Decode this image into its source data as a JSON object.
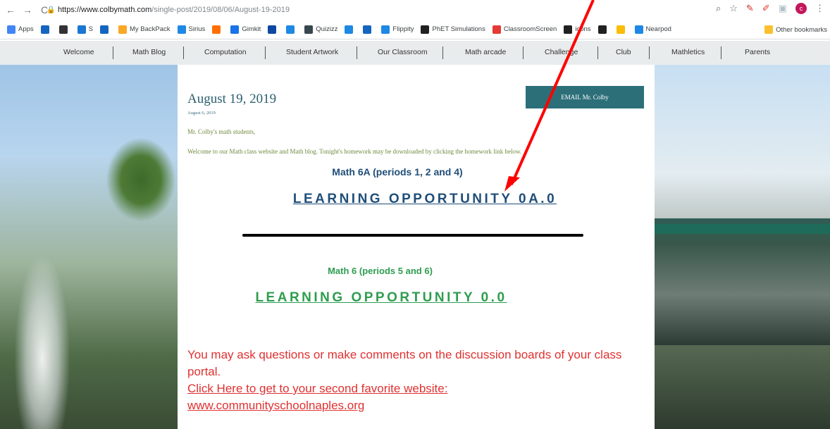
{
  "browser": {
    "url_host": "https://www.colbymath.com",
    "url_path": "/single-post/2019/08/06/August-19-2019",
    "avatar_letter": "c",
    "bookmarks": [
      {
        "label": "Apps",
        "color": "#4285f4"
      },
      {
        "label": "",
        "color": "#1565c0"
      },
      {
        "label": "",
        "color": "#333333"
      },
      {
        "label": "S",
        "color": "#1976d2"
      },
      {
        "label": "",
        "color": "#1565c0"
      },
      {
        "label": "My BackPack",
        "color": "#f9a825"
      },
      {
        "label": "Sirius",
        "color": "#1e88e5"
      },
      {
        "label": "",
        "color": "#ff6f00"
      },
      {
        "label": "Gimkit",
        "color": "#1a73e8"
      },
      {
        "label": "",
        "color": "#0d47a1"
      },
      {
        "label": "",
        "color": "#1e88e5"
      },
      {
        "label": "Quizizz",
        "color": "#37474f"
      },
      {
        "label": "",
        "color": "#1e88e5"
      },
      {
        "label": "",
        "color": "#1565c0"
      },
      {
        "label": "Flippity",
        "color": "#1e88e5"
      },
      {
        "label": "PhET Simulations",
        "color": "#212121"
      },
      {
        "label": "ClassroomScreen",
        "color": "#e53935"
      },
      {
        "label": "icons",
        "color": "#212121"
      },
      {
        "label": "",
        "color": "#212121"
      },
      {
        "label": "",
        "color": "#fbbc05"
      },
      {
        "label": "Nearpod",
        "color": "#1e88e5"
      }
    ],
    "other_bookmarks": "Other bookmarks"
  },
  "site_nav": [
    {
      "label": "Welcome"
    },
    {
      "label": "Math Blog"
    },
    {
      "label": "Computation"
    },
    {
      "label": "Student Artwork"
    },
    {
      "label": "Our Classroom"
    },
    {
      "label": "Math arcade"
    },
    {
      "label": "Challenge"
    },
    {
      "label": "Club"
    },
    {
      "label": "Mathletics"
    },
    {
      "label": "Parents"
    }
  ],
  "post": {
    "title": "August 19, 2019",
    "date": "August 6, 2019",
    "email_button": "EMAIL Mr. Colby",
    "greeting": "Mr. Colby's math students,",
    "welcome": "Welcome to our Math class website and Math blog. Tonight's homework may be downloaded by clicking the homework link below.",
    "section_6a": "Math 6A (periods 1, 2 and 4)",
    "lo_6a": "LEARNING OPPORTUNITY 0A.0",
    "section_6": "Math 6 (periods 5 and 6)",
    "lo_6": "LEARNING OPPORTUNITY 0.0",
    "ask_text": "You may ask questions or make comments on the discussion boards of your class portal.",
    "click_here": "Click Here to get to your second favorite website:",
    "site_link": "www.communityschoolnaples.org"
  },
  "colors": {
    "annotation_arrow": "#ff0000",
    "teal": "#2c6f79",
    "blue_text": "#1f4e79",
    "green_text": "#2e9d4f",
    "red_text": "#e03131"
  }
}
